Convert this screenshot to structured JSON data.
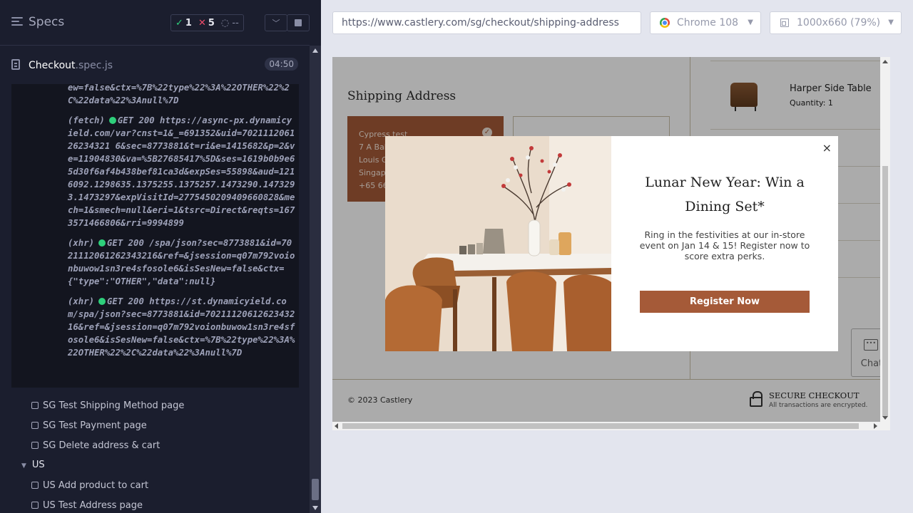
{
  "reporter": {
    "title": "Specs",
    "stats": {
      "passed": "1",
      "failed": "5",
      "pending": "--"
    },
    "spec": {
      "name": "Checkout",
      "ext": ".spec.js",
      "duration": "04:50"
    },
    "log_entries": [
      {
        "prefix": "",
        "text": "ew=false&ctx=%7B%22type%22%3A%22OTHER%22%2C%22data%22%3Anull%7D"
      },
      {
        "prefix": "(fetch)",
        "text": "GET 200 https://async-px.dynamicyield.com/var?cnst=1&_=691352&uid=702111206126234321 6&sec=8773881&t=ri&e=1415682&p=2&ve=11904830&va=%5B27685417%5D&ses=1619b0b9e65d30f6af4b438bef81ca3d&expSes=55898&aud=1216092.1298635.1375255.1375257.1473290.1473293.1473297&expVisitId=2775450209409660828&mech=1&smech=null&eri=1&tsrc=Direct&reqts=1673571466806&rri=9994899"
      },
      {
        "prefix": "(xhr)",
        "text": "GET 200 /spa/json?sec=8773881&id=7021112061262343216&ref=&jsession=q07m792voionbuwow1sn3re4sfosole6&isSesNew=false&ctx={\"type\":\"OTHER\",\"data\":null}"
      },
      {
        "prefix": "(xhr)",
        "text": "GET 200 https://st.dynamicyield.com/spa/json?sec=8773881&id=7021112061262343216&ref=&jsession=q07m792voionbuwow1sn3re4sfosole6&isSesNew=false&ctx=%7B%22type%22%3A%22OTHER%22%2C%22data%22%3Anull%7D"
      }
    ],
    "tests": [
      "SG Test Shipping Method page",
      "SG Test Payment page",
      "SG Delete address & cart"
    ],
    "group": "US",
    "us_tests": [
      "US Add product to cart",
      "US Test Address page"
    ]
  },
  "browser": {
    "url": "https://www.castlery.com/sg/checkout/shipping-address",
    "browser_name": "Chrome 108",
    "viewport": "1000x660",
    "zoom": "(79%)"
  },
  "app": {
    "shipping_title": "Shipping Address",
    "address_lines": [
      "Cypress test",
      "7 A Balm",
      "Louis G",
      "Singap",
      "+65 66"
    ],
    "cart_item": {
      "name": "Harper Side Table",
      "qty": "Quantity: 1"
    },
    "chat_label": "Chat",
    "copyright": "© 2023 Castlery",
    "secure_title": "SECURE CHECKOUT",
    "secure_sub": "All transactions are encrypted."
  },
  "modal": {
    "title": "Lunar New Year: Win a Dining Set*",
    "text": "Ring in the festivities at our in-store event on Jan 14 & 15! Register now to score extra perks.",
    "button": "Register Now",
    "close": "×"
  },
  "colors": {
    "accent": "#a55a38",
    "pass": "#2ecf7b",
    "fail": "#ef4c6a",
    "panel_bg": "#1b1e2e"
  }
}
